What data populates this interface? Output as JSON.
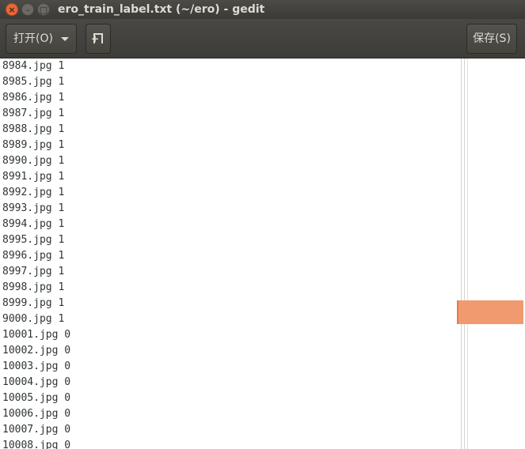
{
  "window": {
    "title": "ero_train_label.txt (~/ero) - gedit",
    "close_glyph": "×",
    "minimize_glyph": "–",
    "maximize_glyph": "□"
  },
  "toolbar": {
    "open_label": "打开(O)",
    "save_label": "保存(S)"
  },
  "editor": {
    "lines": [
      "8984.jpg 1",
      "8985.jpg 1",
      "8986.jpg 1",
      "8987.jpg 1",
      "8988.jpg 1",
      "8989.jpg 1",
      "8990.jpg 1",
      "8991.jpg 1",
      "8992.jpg 1",
      "8993.jpg 1",
      "8994.jpg 1",
      "8995.jpg 1",
      "8996.jpg 1",
      "8997.jpg 1",
      "8998.jpg 1",
      "8999.jpg 1",
      "9000.jpg 1",
      "10001.jpg 0",
      "10002.jpg 0",
      "10003.jpg 0",
      "10004.jpg 0",
      "10005.jpg 0",
      "10006.jpg 0",
      "10007.jpg 0",
      "10008.jpg 0"
    ]
  },
  "colors": {
    "titlebar": "#3b3a36",
    "close_button": "#e8683a",
    "minimap_viewport": "#f19a6f"
  }
}
